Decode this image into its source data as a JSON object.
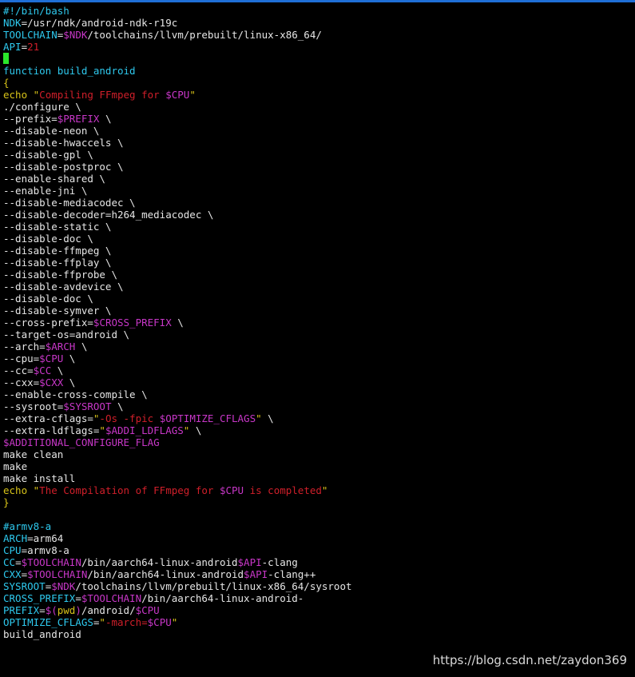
{
  "window": {
    "accent": "#1f6fd6",
    "background": "#000000"
  },
  "colors": {
    "plain": "#e6e6e6",
    "cyan": "#2ec9ee",
    "magenta": "#c837c8",
    "red": "#d11f2a",
    "yellow": "#d8c319",
    "cursor": "#2be82b"
  },
  "terminal": {
    "lines": [
      [
        [
          "#!/bin/bash",
          "cyan"
        ]
      ],
      [
        [
          "NDK",
          "cyan"
        ],
        [
          "=/usr/ndk/android-ndk-r19c",
          "plain"
        ]
      ],
      [
        [
          "TOOLCHAIN",
          "cyan"
        ],
        [
          "=",
          "plain"
        ],
        [
          "$NDK",
          "mag"
        ],
        [
          "/toolchains/llvm/prebuilt/linux-x86_64/",
          "plain"
        ]
      ],
      [
        [
          "API",
          "cyan"
        ],
        [
          "=",
          "plain"
        ],
        [
          "21",
          "red"
        ]
      ],
      [
        [
          "__CURSOR__",
          "cursor"
        ]
      ],
      [
        [
          "function build_android",
          "cyan"
        ]
      ],
      [
        [
          "{",
          "yellow"
        ]
      ],
      [
        [
          "echo ",
          "yellow"
        ],
        [
          "\"",
          "yellow"
        ],
        [
          "Compiling FFmpeg for ",
          "red"
        ],
        [
          "$CPU",
          "mag"
        ],
        [
          "\"",
          "yellow"
        ]
      ],
      [
        [
          "./configure \\",
          "plain"
        ]
      ],
      [
        [
          "--prefix=",
          "plain"
        ],
        [
          "$PREFIX",
          "mag"
        ],
        [
          " \\",
          "plain"
        ]
      ],
      [
        [
          "--disable-neon \\",
          "plain"
        ]
      ],
      [
        [
          "--disable-hwaccels \\",
          "plain"
        ]
      ],
      [
        [
          "--disable-gpl \\",
          "plain"
        ]
      ],
      [
        [
          "--disable-postproc \\",
          "plain"
        ]
      ],
      [
        [
          "--enable-shared \\",
          "plain"
        ]
      ],
      [
        [
          "--enable-jni \\",
          "plain"
        ]
      ],
      [
        [
          "--disable-mediacodec \\",
          "plain"
        ]
      ],
      [
        [
          "--disable-decoder=h264_mediacodec \\",
          "plain"
        ]
      ],
      [
        [
          "--disable-static \\",
          "plain"
        ]
      ],
      [
        [
          "--disable-doc \\",
          "plain"
        ]
      ],
      [
        [
          "--disable-ffmpeg \\",
          "plain"
        ]
      ],
      [
        [
          "--disable-ffplay \\",
          "plain"
        ]
      ],
      [
        [
          "--disable-ffprobe \\",
          "plain"
        ]
      ],
      [
        [
          "--disable-avdevice \\",
          "plain"
        ]
      ],
      [
        [
          "--disable-doc \\",
          "plain"
        ]
      ],
      [
        [
          "--disable-symver \\",
          "plain"
        ]
      ],
      [
        [
          "--cross-prefix=",
          "plain"
        ],
        [
          "$CROSS_PREFIX",
          "mag"
        ],
        [
          " \\",
          "plain"
        ]
      ],
      [
        [
          "--target-os=android \\",
          "plain"
        ]
      ],
      [
        [
          "--arch=",
          "plain"
        ],
        [
          "$ARCH",
          "mag"
        ],
        [
          " \\",
          "plain"
        ]
      ],
      [
        [
          "--cpu=",
          "plain"
        ],
        [
          "$CPU",
          "mag"
        ],
        [
          " \\",
          "plain"
        ]
      ],
      [
        [
          "--cc=",
          "plain"
        ],
        [
          "$CC",
          "mag"
        ],
        [
          " \\",
          "plain"
        ]
      ],
      [
        [
          "--cxx=",
          "plain"
        ],
        [
          "$CXX",
          "mag"
        ],
        [
          " \\",
          "plain"
        ]
      ],
      [
        [
          "--enable-cross-compile \\",
          "plain"
        ]
      ],
      [
        [
          "--sysroot=",
          "plain"
        ],
        [
          "$SYSROOT",
          "mag"
        ],
        [
          " \\",
          "plain"
        ]
      ],
      [
        [
          "--extra-cflags=",
          "plain"
        ],
        [
          "\"",
          "yellow"
        ],
        [
          "-Os -fpic ",
          "red"
        ],
        [
          "$OPTIMIZE_CFLAGS",
          "mag"
        ],
        [
          "\"",
          "yellow"
        ],
        [
          " \\",
          "plain"
        ]
      ],
      [
        [
          "--extra-ldflags=",
          "plain"
        ],
        [
          "\"",
          "yellow"
        ],
        [
          "$ADDI_LDFLAGS",
          "mag"
        ],
        [
          "\"",
          "yellow"
        ],
        [
          " \\",
          "plain"
        ]
      ],
      [
        [
          "$ADDITIONAL_CONFIGURE_FLAG",
          "mag"
        ]
      ],
      [
        [
          "make clean",
          "plain"
        ]
      ],
      [
        [
          "make",
          "plain"
        ]
      ],
      [
        [
          "make install",
          "plain"
        ]
      ],
      [
        [
          "echo ",
          "yellow"
        ],
        [
          "\"",
          "yellow"
        ],
        [
          "The Compilation of FFmpeg for ",
          "red"
        ],
        [
          "$CPU",
          "mag"
        ],
        [
          " is completed",
          "red"
        ],
        [
          "\"",
          "yellow"
        ]
      ],
      [
        [
          "}",
          "yellow"
        ]
      ],
      [
        [
          "",
          "plain"
        ]
      ],
      [
        [
          "#armv8-a",
          "cyan"
        ]
      ],
      [
        [
          "ARCH",
          "cyan"
        ],
        [
          "=arm64",
          "plain"
        ]
      ],
      [
        [
          "CPU",
          "cyan"
        ],
        [
          "=armv8-a",
          "plain"
        ]
      ],
      [
        [
          "CC",
          "cyan"
        ],
        [
          "=",
          "plain"
        ],
        [
          "$TOOLCHAIN",
          "mag"
        ],
        [
          "/bin/aarch64-linux-android",
          "plain"
        ],
        [
          "$API",
          "mag"
        ],
        [
          "-clang",
          "plain"
        ]
      ],
      [
        [
          "CXX",
          "cyan"
        ],
        [
          "=",
          "plain"
        ],
        [
          "$TOOLCHAIN",
          "mag"
        ],
        [
          "/bin/aarch64-linux-android",
          "plain"
        ],
        [
          "$API",
          "mag"
        ],
        [
          "-clang++",
          "plain"
        ]
      ],
      [
        [
          "SYSROOT",
          "cyan"
        ],
        [
          "=",
          "plain"
        ],
        [
          "$NDK",
          "mag"
        ],
        [
          "/toolchains/llvm/prebuilt/linux-x86_64/sysroot",
          "plain"
        ]
      ],
      [
        [
          "CROSS_PREFIX",
          "cyan"
        ],
        [
          "=",
          "plain"
        ],
        [
          "$TOOLCHAIN",
          "mag"
        ],
        [
          "/bin/aarch64-linux-android-",
          "plain"
        ]
      ],
      [
        [
          "PREFIX",
          "cyan"
        ],
        [
          "=",
          "plain"
        ],
        [
          "$(",
          "mag"
        ],
        [
          "pwd",
          "yellow"
        ],
        [
          ")",
          "mag"
        ],
        [
          "/android/",
          "plain"
        ],
        [
          "$CPU",
          "mag"
        ]
      ],
      [
        [
          "OPTIMIZE_CFLAGS",
          "cyan"
        ],
        [
          "=",
          "plain"
        ],
        [
          "\"",
          "yellow"
        ],
        [
          "-march=",
          "red"
        ],
        [
          "$CPU",
          "mag"
        ],
        [
          "\"",
          "yellow"
        ]
      ],
      [
        [
          "build_android",
          "plain"
        ]
      ]
    ]
  },
  "watermark": {
    "text": "https://blog.csdn.net/zaydon369"
  }
}
